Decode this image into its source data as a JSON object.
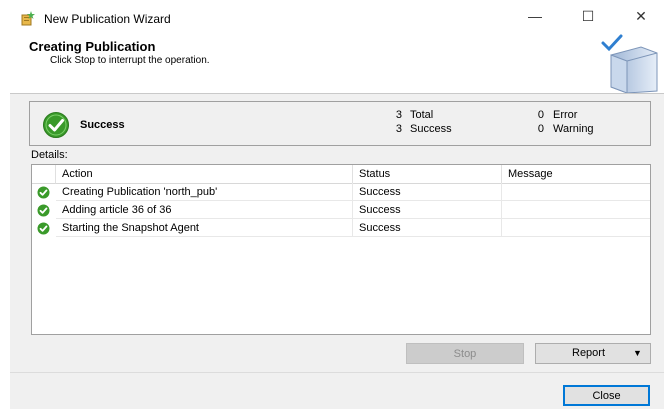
{
  "window": {
    "title": "New Publication Wizard",
    "minimize_glyph": "—",
    "maximize_glyph": "☐",
    "close_glyph": "✕"
  },
  "header": {
    "title": "Creating Publication",
    "subtitle": "Click Stop to interrupt the operation."
  },
  "summary": {
    "status": "Success",
    "total_count": "3",
    "total_label": "Total",
    "success_count": "3",
    "success_label": "Success",
    "error_count": "0",
    "error_label": "Error",
    "warning_count": "0",
    "warning_label": "Warning"
  },
  "details": {
    "label": "Details:",
    "columns": [
      "Action",
      "Status",
      "Message"
    ],
    "rows": [
      {
        "action": "Creating Publication 'north_pub'",
        "status": "Success",
        "message": "",
        "icon": "success-check-icon"
      },
      {
        "action": "Adding article 36 of 36",
        "status": "Success",
        "message": "",
        "icon": "success-check-icon"
      },
      {
        "action": "Starting the Snapshot Agent",
        "status": "Success",
        "message": "",
        "icon": "success-check-icon"
      }
    ]
  },
  "buttons": {
    "stop": "Stop",
    "report": "Report",
    "report_arrow": "▼",
    "close": "Close"
  },
  "colors": {
    "success_green": "#3a9a2a",
    "accent_blue": "#0078d7"
  }
}
